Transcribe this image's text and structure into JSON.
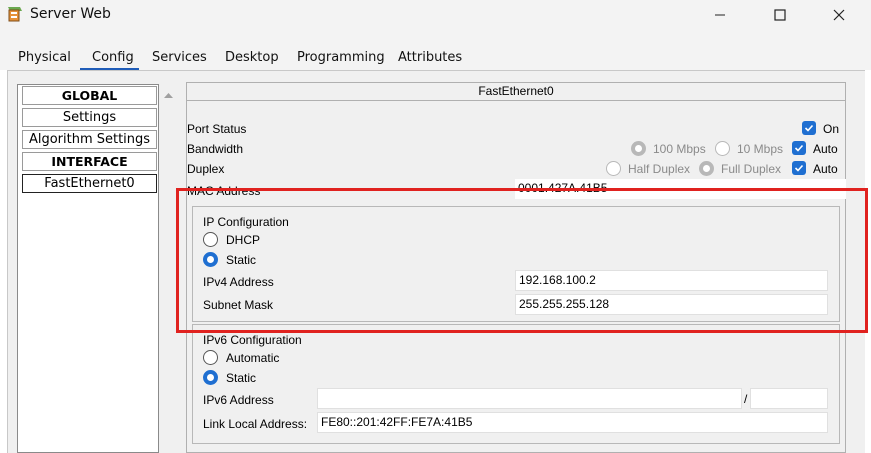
{
  "window": {
    "title": "Server Web",
    "app_icon": "packet-tracer-server-icon",
    "controls": {
      "minimize": "minimize-icon",
      "maximize": "maximize-icon",
      "close": "close-icon"
    }
  },
  "tabs": [
    {
      "label": "Physical"
    },
    {
      "label": "Config",
      "active": true
    },
    {
      "label": "Services"
    },
    {
      "label": "Desktop"
    },
    {
      "label": "Programming"
    },
    {
      "label": "Attributes"
    }
  ],
  "sidebar": {
    "items": [
      {
        "label": "GLOBAL",
        "header": true
      },
      {
        "label": "Settings"
      },
      {
        "label": "Algorithm Settings"
      },
      {
        "label": "INTERFACE",
        "header": true
      },
      {
        "label": "FastEthernet0",
        "selected": true
      }
    ]
  },
  "panel": {
    "title": "FastEthernet0",
    "port_status": {
      "label": "Port Status",
      "on_label": "On",
      "on": true
    },
    "bandwidth": {
      "label": "Bandwidth",
      "opt_100": "100 Mbps",
      "opt_10": "10 Mbps",
      "auto_label": "Auto",
      "auto": true
    },
    "duplex": {
      "label": "Duplex",
      "opt_half": "Half Duplex",
      "opt_full": "Full Duplex",
      "auto_label": "Auto",
      "auto": true
    },
    "mac": {
      "label": "MAC Address",
      "value": "0001.427A.41B5"
    },
    "ip_config": {
      "title": "IP Configuration",
      "dhcp_label": "DHCP",
      "static_label": "Static",
      "mode": "Static",
      "ipv4_label": "IPv4 Address",
      "ipv4_value": "192.168.100.2",
      "mask_label": "Subnet Mask",
      "mask_value": "255.255.255.128"
    },
    "ipv6_config": {
      "title": "IPv6 Configuration",
      "auto_label": "Automatic",
      "static_label": "Static",
      "mode": "Static",
      "ipv6_label": "IPv6 Address",
      "ipv6_value": "",
      "prefix_sep": "/",
      "prefix_value": "",
      "link_local_label": "Link Local Address:",
      "link_local_value": "FE80::201:42FF:FE7A:41B5"
    }
  },
  "colors": {
    "accent": "#1f6fd1",
    "highlight_box": "#e0221f",
    "tab_underline": "#1f5cb8"
  }
}
